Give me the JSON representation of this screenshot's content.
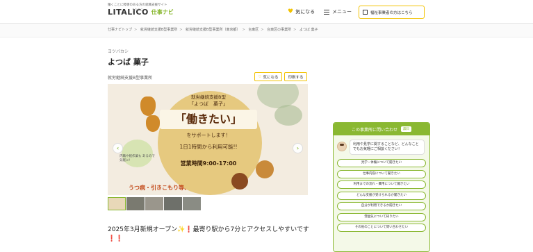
{
  "header": {
    "tagline": "働くことに障害のある方の就職支援サイト",
    "logo": "LITALICO",
    "logo_ruby": "りたりこ",
    "logo_sub": "仕事ナビ",
    "favorites_label": "気になる",
    "menu_label": "メニュー",
    "business_button_label": "福祉事業者の方はこちら"
  },
  "breadcrumb": [
    "仕事ナビトップ",
    "就労継続支援B型事業所",
    "就労継続支援B型事業所（東京都）",
    "台東区",
    "台東区の事業所",
    "よつば 菓子"
  ],
  "facility": {
    "name_kana": "ヨツバカシ",
    "name": "よつば 菓子",
    "service_type": "就労継続支援B型事業所",
    "favorite_button": "気になる",
    "print_button": "印刷する"
  },
  "hero": {
    "badge": "就労継続支援B型",
    "line1": "就労継続支援B型",
    "line2": "「よつば　菓子」",
    "big": "「働きたい」",
    "line3": "をサポートします！",
    "line4": "1日1時間から利用可能!!",
    "line5": "営業時間9:00-17:00",
    "bottom": "うつ病・引きこもり等、",
    "note": "内職や軽作業も あるので気軽に!"
  },
  "description": "2025年3月新規オープン✨❗最寄り駅から7分とアクセスしやすいです❗❗",
  "contact": {
    "header": "この事業所に問い合わせ",
    "free_badge": "無料",
    "question": "利用や見学に関することなど、どんなことでもお気軽にご相談ください！",
    "options": [
      "見学・体験について聞きたい",
      "仕事内容について聞きたい",
      "利用までの流れ・費用について聞きたい",
      "どんな支援が受けられるか聞きたい",
      "自分が利用できるか聞きたい",
      "雰囲気について知りたい",
      "その他のことについて問い合わせたい"
    ]
  },
  "colors": {
    "accent_green": "#8ab832",
    "accent_yellow": "#f2c200"
  }
}
